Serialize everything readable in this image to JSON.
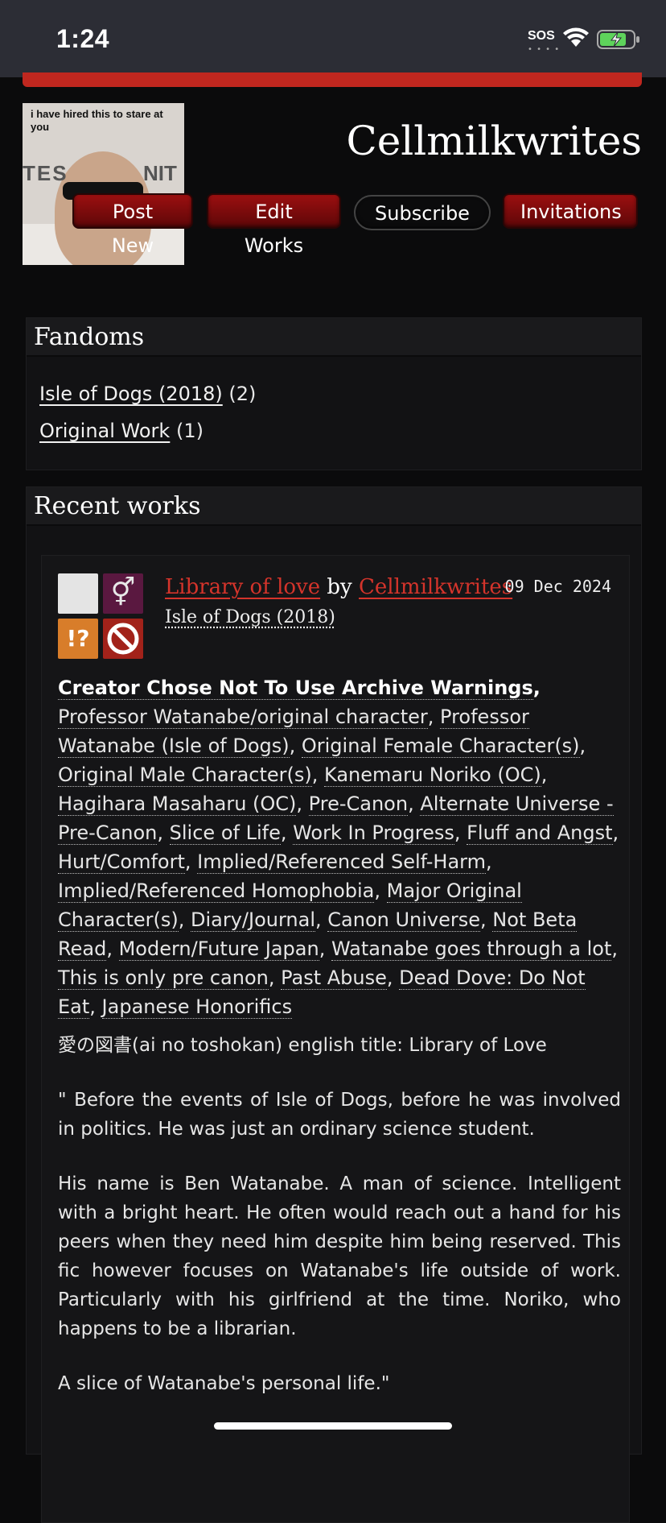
{
  "status_bar": {
    "time": "1:24",
    "sos": "SOS"
  },
  "profile": {
    "username": "Cellmilkwrites",
    "avatar_caption": "i have hired this    to stare at you",
    "avatar_text_left": "TES",
    "avatar_text_right": "NIT",
    "buttons": {
      "post_new": "Post New",
      "edit_works": "Edit Works",
      "subscribe": "Subscribe",
      "invitations": "Invitations"
    }
  },
  "fandoms": {
    "heading": "Fandoms",
    "items": [
      {
        "name": "Isle of Dogs (2018)",
        "count": "(2)"
      },
      {
        "name": "Original Work",
        "count": "(1)"
      }
    ]
  },
  "recent_works": {
    "heading": "Recent works",
    "work": {
      "title": "Library of love",
      "by": "by",
      "author": "Cellmilkwrites",
      "date": "09 Dec 2024",
      "fandom": "Isle of Dogs (2018)",
      "warning": "Creator Chose Not To Use Archive Warnings",
      "tags": [
        "Professor Watanabe/original character",
        "Professor Watanabe (Isle of Dogs)",
        "Original Female Character(s)",
        "Original Male Character(s)",
        "Kanemaru Noriko (OC)",
        "Hagihara Masaharu (OC)",
        "Pre-Canon",
        "Alternate Universe - Pre-Canon",
        "Slice of Life",
        "Work In Progress",
        "Fluff and Angst",
        "Hurt/Comfort",
        "Implied/Referenced Self-Harm",
        "Implied/Referenced Homophobia",
        "Major Original Character(s)",
        "Diary/Journal",
        "Canon Universe",
        "Not Beta Read",
        "Modern/Future Japan",
        "Watanabe goes through a lot",
        "This is only pre canon",
        "Past Abuse",
        "Dead Dove: Do Not Eat",
        "Japanese Honorifics"
      ],
      "summary": [
        "愛の図書(ai no toshokan) english title: Library of Love",
        "\" Before the events of Isle of Dogs, before he was involved in politics. He was just an ordinary science student.",
        "His name is Ben Watanabe. A man of science. Intelligent with a bright heart. He often would reach out a hand for his peers when they need him despite him being reserved. This fic however focuses on Watanabe's life outside of work. Particularly with his girlfriend at the time. Noriko, who happens to be a librarian.",
        "A slice of Watanabe's personal life.\""
      ],
      "icons": {
        "rating": "rating-not-rated-icon",
        "category": "category-multi-icon",
        "warning": "warning-choose-not-to-use-icon",
        "status": "work-in-progress-icon"
      }
    }
  },
  "colors": {
    "accent_red": "#c0271f",
    "link_red": "#d4342b",
    "background": "#0b0b0c"
  }
}
